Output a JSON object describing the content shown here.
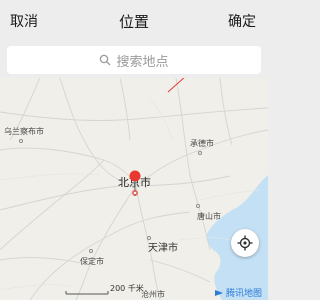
{
  "nav": {
    "cancel_label": "取消",
    "title": "位置",
    "confirm_label": "确定"
  },
  "search": {
    "placeholder": "搜索地点"
  },
  "map": {
    "labels": {
      "wulanchabu": "乌兰察布市",
      "chengde": "承德市",
      "beijing": "北京市",
      "tangshan": "唐山市",
      "tianjin": "天津市",
      "baoding": "保定市",
      "cangzhou": "沧州市"
    },
    "scale": "200 千米",
    "provider": "腾讯地图"
  },
  "colors": {
    "pin": "#e8382f",
    "water": "#c4e0f4",
    "road": "#cfcfcf",
    "annotation_arrow": "#e53935",
    "logo": "#2b7bd6"
  },
  "icons": {
    "search": "search-icon",
    "locate": "locate-icon",
    "pin": "location-pin-icon"
  }
}
